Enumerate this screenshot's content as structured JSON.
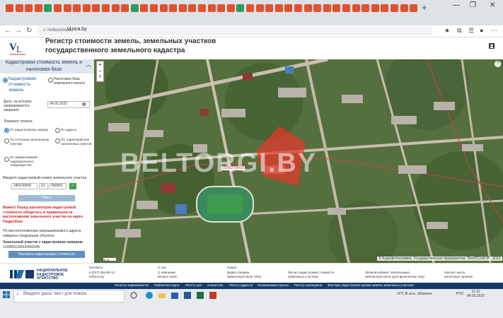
{
  "browser": {
    "security_label": "Небезопасно",
    "url": "vl.nca.by",
    "window_controls": [
      "minimize-icon",
      "restore-icon",
      "close-icon"
    ],
    "tab_colors": [
      "#e0522f",
      "#e0522f",
      "#e0522f",
      "#e0522f",
      "#2e9a5c",
      "#e0522f",
      "#e0522f",
      "#e0522f",
      "#e0522f",
      "#e0522f",
      "#e0522f",
      "#e0522f",
      "#e0522f",
      "#2e9a5c",
      "#e0522f",
      "#e0522f",
      "#e0522f",
      "#e0522f",
      "#e0522f",
      "#e0522f",
      "#e0522f",
      "#e0522f",
      "#e0522f",
      "#e0522f",
      "#2e9a5c",
      "#e0522f",
      "#e0522f",
      "#e0522f",
      "#e0522f",
      "#e0522f",
      "#e0522f",
      "#e0522f",
      "#e0522f",
      "#e0522f",
      "#e0522f",
      "#e0522f",
      "#e0522f",
      "#e0522f",
      "#e0522f",
      "#e0522f",
      "#e0522f",
      "#e0522f",
      "#e0522f"
    ]
  },
  "site": {
    "title_line1": "Регистр стоимости земель, земельных участков",
    "title_line2": "государственного земельного кадастра"
  },
  "panel": {
    "title": "Кадастровая стоимость земель и налоговая база",
    "mode_cadastral": "Кадастровая стоимость земель",
    "mode_tax": "Налоговая база земельного налога",
    "date_label": "Дата, на которую запрашиваются сведения",
    "date_value": "04.02.2022",
    "search_variant_label": "Вариант поиска",
    "opt_by_cadastral": "По кадастровому номеру",
    "opt_by_address": "По адресу",
    "opt_rural": "По сельским населенным пунктам",
    "opt_territory": "По территории вне населенных пунктов",
    "opt_garden": "По наименованию садоводческого товарищества",
    "enter_number_label": "Введите кадастровый номер земельного участка",
    "num_part1": "240100000",
    "num_part2": "01",
    "num_part3": "000002",
    "search_button": "Поиск",
    "warning": "Важно! Перед просмотром кадастровой стоимости убедитесь в правильности расположения земельного участка на карте. Подробнее",
    "found_text": "По местоположению запрашиваемого адреса найдены следующие объекты:",
    "parcel_label": "Земельный участок с кадастровым номером:",
    "parcel_number": "120850100002000948",
    "show_button": "Показать кадастровую стоимость"
  },
  "map": {
    "watermark": "BELTORGI.BY",
    "parcel_tag": "1508270003",
    "copyright": "© Аэрофотоснимка, Государственное предприятие \"БелПСХАГИ\", 2022",
    "scale": "50 м"
  },
  "footer": {
    "agency": "НАЦИОНАЛЬНОЕ КАДАСТРОВОЕ АГЕНТСТВО",
    "contacts_title": "Контакты",
    "contacts_phone": "8 (017) 284-85-13",
    "contacts_email": "vl@nca.by",
    "about_title": "О нас",
    "about_1": "О компании",
    "about_2": "Вопрос-ответ",
    "news_title": "Новое",
    "news_1": "Видео справки",
    "news_2": "Земельный налог 2022",
    "calc_title": "Расчет кадастровой стоимости",
    "calc_sub": "земельных участков",
    "cabinet_title": "Личный кабинет плательщика",
    "cabinet_sub": "Земельный налог (для физических лиц)",
    "contact_center": "Контакт центр",
    "contact_center_sub": "налоговых органов",
    "nav": [
      "Регистр недвижимости",
      "Публичная карта",
      "Реестр цен",
      "Аналитика",
      "Реестр адресов",
      "Независимая оценка",
      "Реестр оценщиков",
      "Факторы кадастровой оценки земель земельных участков"
    ]
  },
  "taskbar": {
    "search_placeholder": "Введите здесь текст для поиска",
    "weather": "-9°C  В осн. облачно",
    "lang": "РУС",
    "time": "11:11",
    "date": "04.02.2022"
  }
}
